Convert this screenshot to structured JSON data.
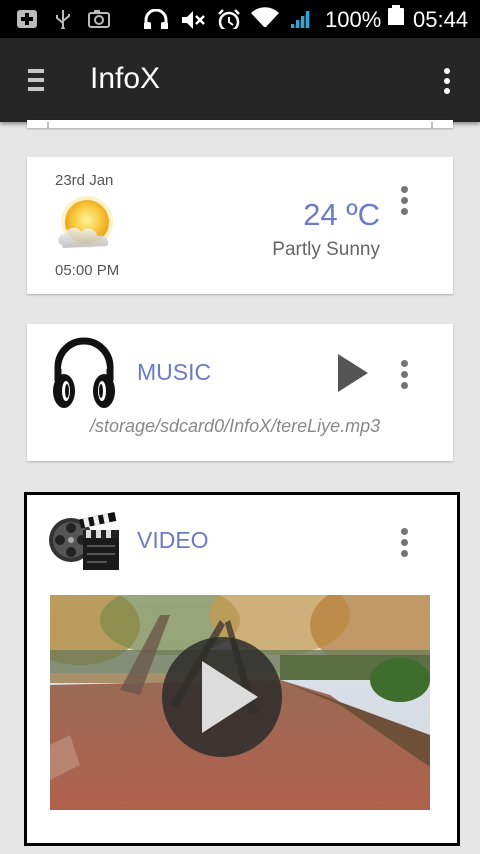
{
  "status_bar": {
    "battery": "100%",
    "time": "05:44"
  },
  "app_bar": {
    "title": "InfoX"
  },
  "weather": {
    "date": "23rd Jan",
    "time": "05:00 PM",
    "temperature": "24 ºC",
    "condition": "Partly Sunny"
  },
  "music": {
    "label": "MUSIC",
    "path": "/storage/sdcard0/InfoX/tereLiye.mp3"
  },
  "video": {
    "label": "VIDEO"
  },
  "colors": {
    "accent": "#6b7bc4",
    "app_bar": "#262626",
    "background": "#e6e6e6"
  }
}
